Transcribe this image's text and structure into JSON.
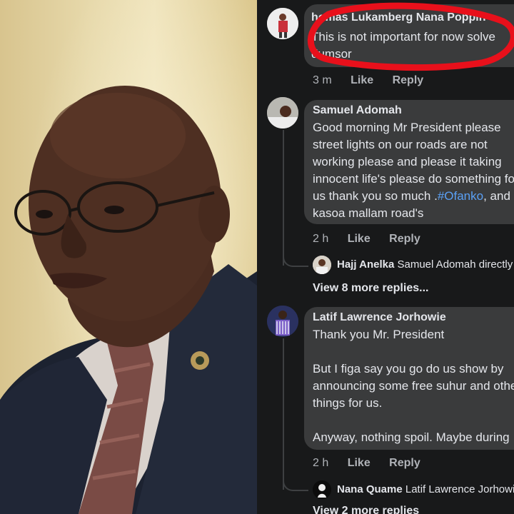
{
  "comments": [
    {
      "author": "Thomas Lukamberg Nana Poppin",
      "author_visible": "homas Lukamberg Nana Poppin",
      "text_line1": "This is not important for now solve",
      "text_line2": "dumsor",
      "time": "3 m",
      "like": "Like",
      "reply": "Reply"
    },
    {
      "author": "Samuel Adomah",
      "lines": [
        "Good morning Mr President please",
        "street lights on our roads are not",
        "working please and please it taking",
        "innocent life's please do something for",
        "kasoa mallam road's"
      ],
      "line5_prefix": "us thank you so much .",
      "line5_hashtag": "#Ofanko",
      "line5_suffix": ", and",
      "time": "2 h",
      "like": "Like",
      "reply": "Reply",
      "reply_preview": {
        "name": "Hajj Anelka",
        "text": "Samuel Adomah  directly"
      },
      "more_replies": "View 8 more replies..."
    },
    {
      "author": "Latif Lawrence Jorhowie",
      "lines": [
        "Thank you Mr. President",
        "",
        "But I figa say you go do us show by",
        "announcing some free suhur and other",
        "things for us.",
        "",
        "Anyway, nothing spoil. Maybe during"
      ],
      "time": "2 h",
      "like": "Like",
      "reply": "Reply",
      "reply_preview": {
        "name": "Nana Quame",
        "text": "Latif Lawrence Jorhowie"
      },
      "more_replies": "View 2 more replies"
    }
  ],
  "icons": {
    "highlight": "red-circle-annotation",
    "pin": "lapel-pin-icon"
  },
  "colors": {
    "background": "#18191a",
    "bubble": "#3a3b3c",
    "text": "#e4e6eb",
    "muted": "#b0b3b8",
    "hashtag": "#5aa0f5",
    "annotation": "#e8101b"
  }
}
